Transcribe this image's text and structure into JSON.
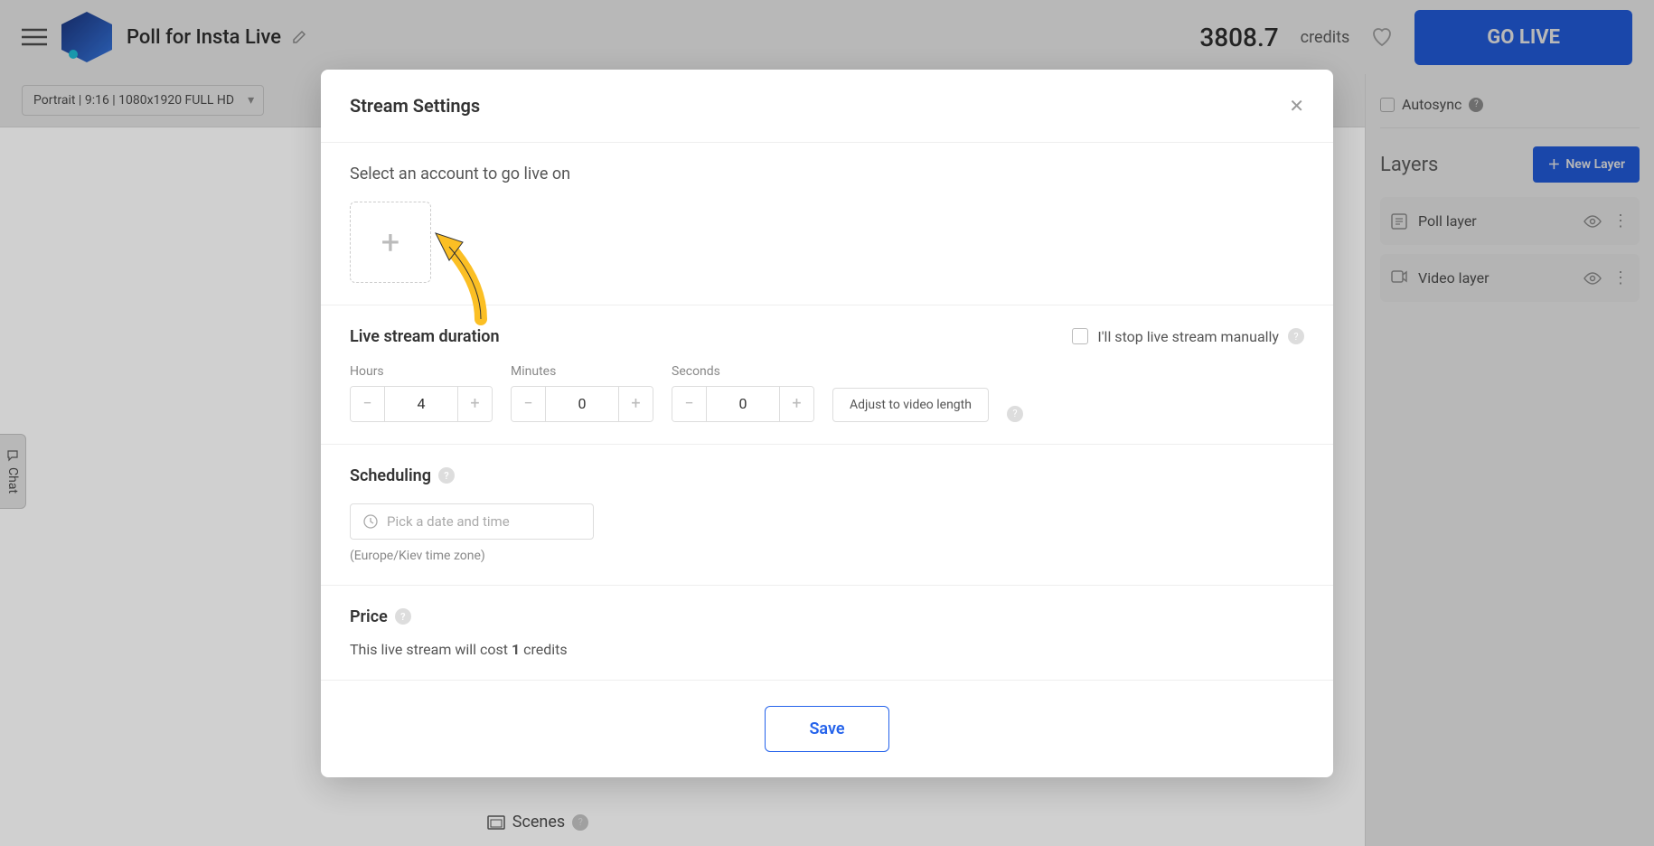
{
  "header": {
    "project_title": "Poll for Insta Live",
    "credits_value": "3808.7",
    "credits_label": "credits",
    "go_live_label": "GO LIVE"
  },
  "toolbar": {
    "format_option": "Portrait | 9:16 | 1080x1920 FULL HD"
  },
  "right_panel": {
    "autosync_label": "Autosync",
    "layers_title": "Layers",
    "new_layer_label": "New Layer",
    "layers": [
      {
        "name": "Poll layer"
      },
      {
        "name": "Video layer"
      }
    ]
  },
  "scenes_label": "Scenes",
  "chat_label": "Chat",
  "modal": {
    "title": "Stream Settings",
    "account_section_label": "Select an account to go live on",
    "duration_title": "Live stream duration",
    "manual_stop_label": "I'll stop live stream manually",
    "hours_label": "Hours",
    "minutes_label": "Minutes",
    "seconds_label": "Seconds",
    "hours_value": "4",
    "minutes_value": "0",
    "seconds_value": "0",
    "adjust_label": "Adjust to video length",
    "scheduling_title": "Scheduling",
    "date_placeholder": "Pick a date and time",
    "timezone_text": "(Europe/Kiev time zone)",
    "price_title": "Price",
    "price_prefix": "This live stream will cost ",
    "price_value": "1",
    "price_suffix": " credits",
    "save_label": "Save"
  }
}
